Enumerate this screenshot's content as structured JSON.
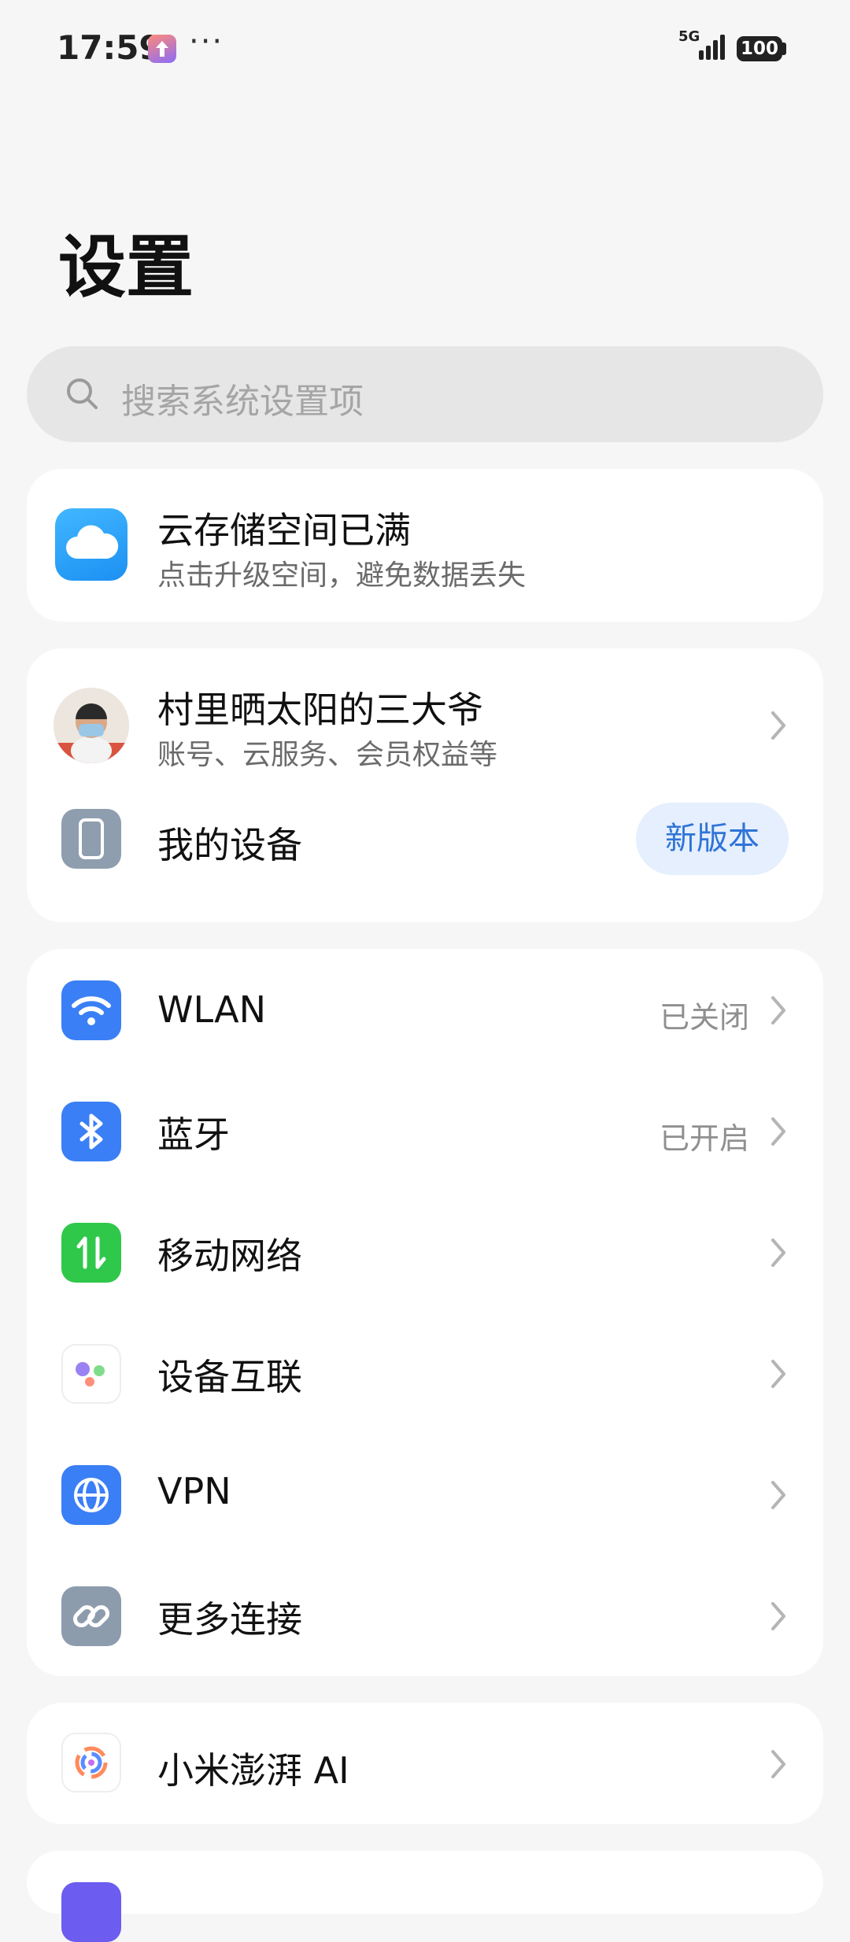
{
  "status_bar": {
    "time": "17:59",
    "overflow": "···",
    "network": "5G",
    "battery": "100"
  },
  "page": {
    "title": "设置"
  },
  "search": {
    "placeholder": "搜索系统设置项"
  },
  "cloud_banner": {
    "title": "云存储空间已满",
    "subtitle": "点击升级空间，避免数据丢失",
    "icon": "cloud-icon"
  },
  "account": {
    "name": "村里晒太阳的三大爷",
    "subtitle": "账号、云服务、会员权益等"
  },
  "my_device": {
    "label": "我的设备",
    "badge": "新版本"
  },
  "connectivity": {
    "items": [
      {
        "label": "WLAN",
        "status": "已关闭",
        "icon": "wifi-icon",
        "color": "#3a7ff5"
      },
      {
        "label": "蓝牙",
        "status": "已开启",
        "icon": "bluetooth-icon",
        "color": "#3a7ff5"
      },
      {
        "label": "移动网络",
        "status": "",
        "icon": "mobile-data-icon",
        "color": "#2fc84a"
      },
      {
        "label": "设备互联",
        "status": "",
        "icon": "device-connect-icon",
        "color": "#ffffff"
      },
      {
        "label": "VPN",
        "status": "",
        "icon": "globe-icon",
        "color": "#3a7ff5"
      },
      {
        "label": "更多连接",
        "status": "",
        "icon": "link-icon",
        "color": "#8d9cad"
      }
    ]
  },
  "ai": {
    "label": "小米澎湃 AI",
    "icon": "xiaomi-ai-icon"
  }
}
